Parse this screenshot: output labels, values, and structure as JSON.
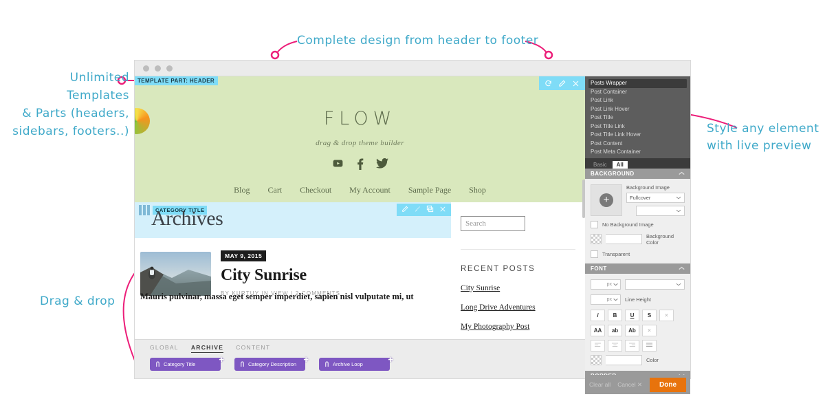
{
  "annotations": {
    "templates": "Unlimited Templates\n& Parts (headers,\nsidebars, footers..)",
    "complete": "Complete design from header to footer",
    "style": "Style any element\nwith live preview",
    "drag": "Drag & drop"
  },
  "browser": {
    "template_part_badge": "TEMPLATE PART: HEADER"
  },
  "site": {
    "logo": "FLOW",
    "tagline": "drag & drop theme builder",
    "social": [
      "youtube-icon",
      "facebook-icon",
      "twitter-icon"
    ],
    "nav": [
      "Blog",
      "Cart",
      "Checkout",
      "My Account",
      "Sample Page",
      "Shop"
    ]
  },
  "archive": {
    "badge": "CATEGORY TITLE",
    "title": "Archives",
    "tools": [
      "pencil-icon",
      "brush-icon",
      "duplicate-icon",
      "close-icon"
    ]
  },
  "post": {
    "date": "MAY 9, 2015",
    "title": "City Sunrise",
    "meta": "BY KURTUY IN VIEW | 2 COMMENTS",
    "excerpt": "Mauris pulvinar, massa eget semper imperdiet, sapien nisl vulputate mi, ut"
  },
  "sidebar": {
    "search_placeholder": "Search",
    "recent_heading": "RECENT POSTS",
    "recent_posts": [
      "City Sunrise",
      "Long Drive Adventures",
      "My Photography Post"
    ]
  },
  "dock": {
    "tabs": [
      "GLOBAL",
      "ARCHIVE",
      "CONTENT"
    ],
    "active_tab": "ARCHIVE",
    "chips": [
      "Category Title",
      "Category Description",
      "Archive Loop"
    ]
  },
  "panel": {
    "selectors": [
      "Posts Wrapper",
      "Post Container",
      "Post Link",
      "Post Link Hover",
      "Post Title",
      "Post Title Link",
      "Post Title Link Hover",
      "Post Content",
      "Post Meta Container"
    ],
    "active_selector": "Posts Wrapper",
    "tabs": [
      "Basic",
      "All"
    ],
    "active_tab": "All",
    "background": {
      "heading": "BACKGROUND",
      "image_label": "Background Image",
      "image_mode": "Fullcover",
      "image_mode2": "",
      "no_image_label": "No Background Image",
      "color_label": "Background Color",
      "transparent_label": "Transparent"
    },
    "font": {
      "heading": "FONT",
      "size_unit": "px",
      "family": "",
      "line_height_unit": "px",
      "line_height_label": "Line Height",
      "style_buttons": [
        "i",
        "B",
        "U",
        "S",
        "×"
      ],
      "case_buttons": [
        "AA",
        "ab",
        "Ab",
        "×"
      ],
      "align_buttons": [
        "align-left-icon",
        "align-center-icon",
        "align-right-icon",
        "align-justify-icon"
      ],
      "color_label": "Color"
    },
    "border": {
      "heading": "BORDER"
    },
    "footer": {
      "clear": "Clear all",
      "cancel": "Cancel",
      "done": "Done"
    }
  }
}
